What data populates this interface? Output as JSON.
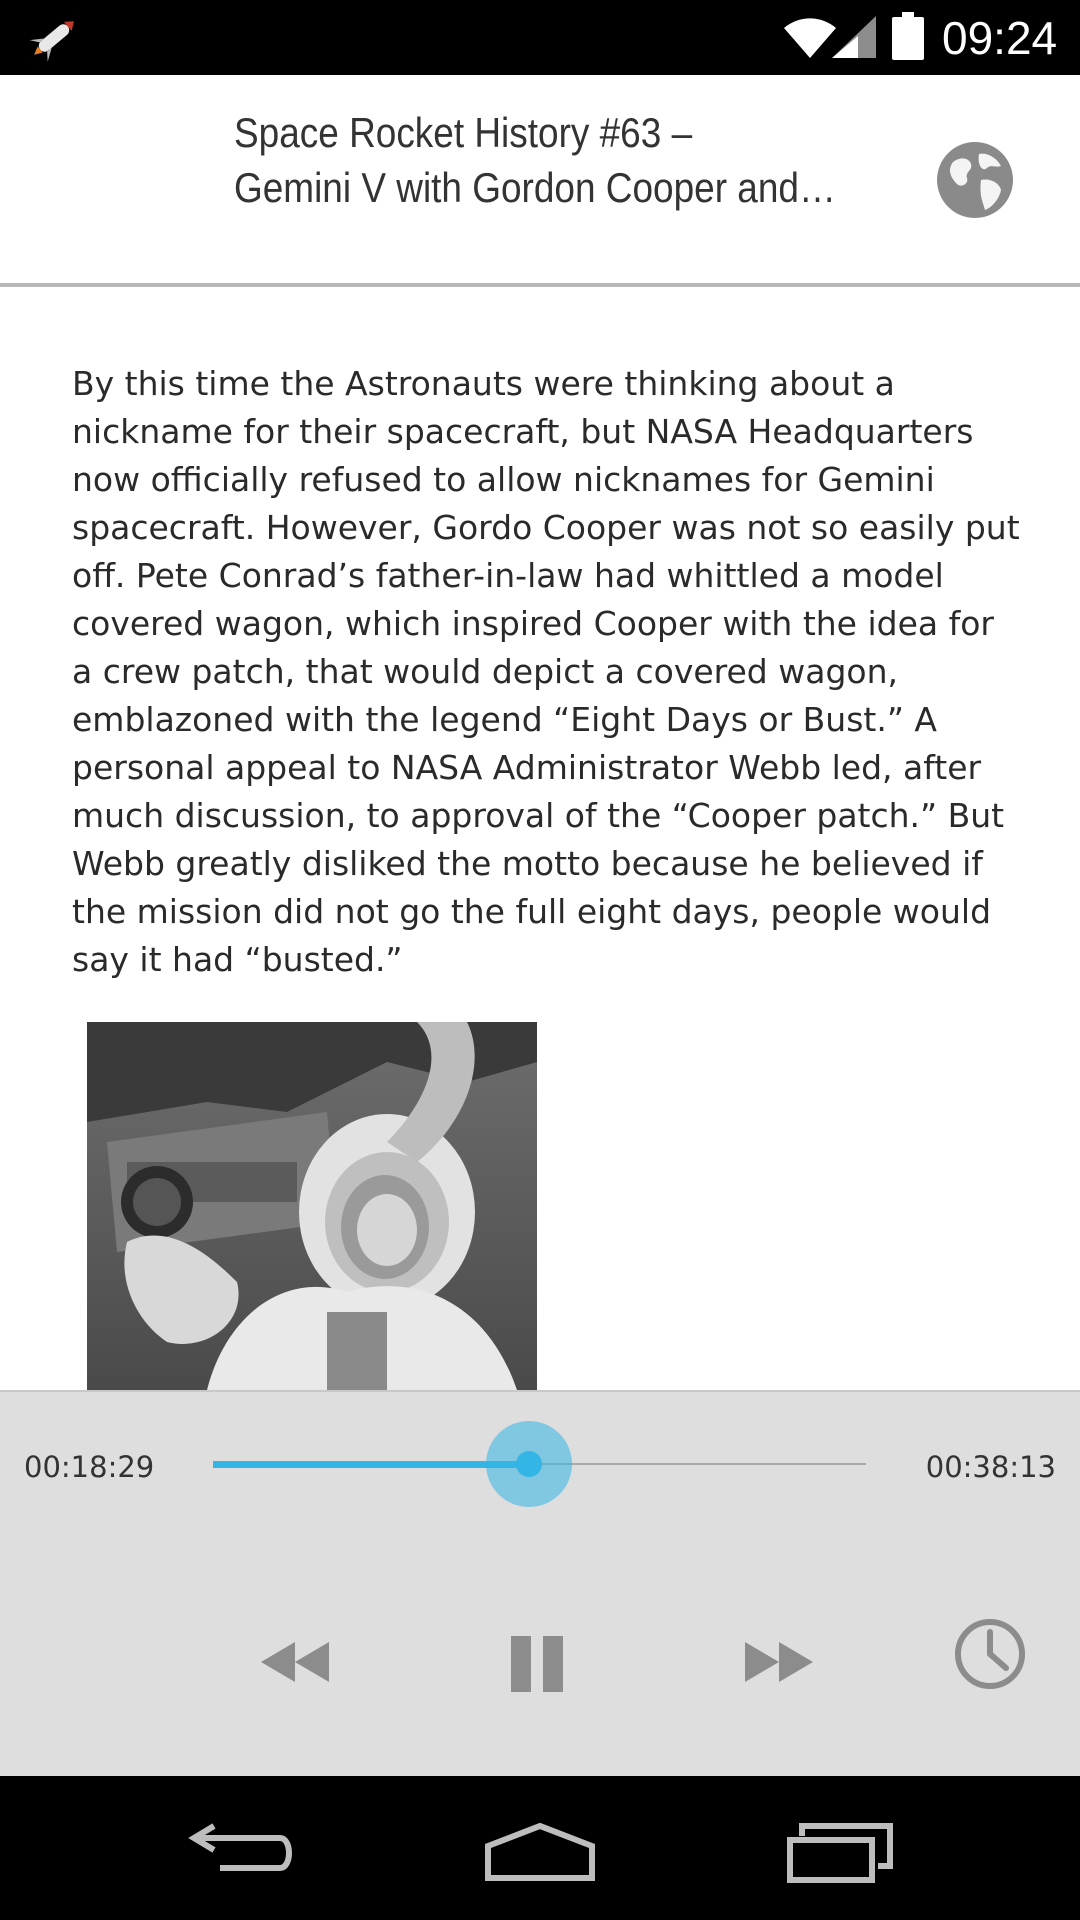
{
  "status_bar": {
    "time": "09:24",
    "icons": [
      "rocket-app-icon",
      "wifi-icon",
      "signal-icon",
      "battery-icon"
    ]
  },
  "header": {
    "title_line1": "Space Rocket History #63 –",
    "title_line2": "Gemini V with Gordon Cooper and…",
    "action_icon": "globe-icon"
  },
  "article": {
    "body": "By this time the Astronauts were thinking about a nickname for their spacecraft, but NASA Headquarters now officially refused to allow nicknames for Gemini spacecraft. However, Gordo Cooper was not so easily put off. Pete Conrad’s father-in-law had whittled a model covered wagon, which inspired Cooper with the idea for a crew patch, that would depict a covered wagon, emblazoned with the legend “Eight Days or Bust.” A personal appeal to NASA Administrator Webb led, after much discussion, to approval of the “Cooper patch.” But Webb greatly disliked the motto because he believed if the mission did not go the full eight days, people would say it had “busted.”",
    "image_icon": "astronaut-photo"
  },
  "player": {
    "elapsed": "00:18:29",
    "total": "00:38:13",
    "progress": 0.4837,
    "controls": [
      "rewind-icon",
      "pause-icon",
      "fast-forward-icon",
      "sleep-timer-icon"
    ],
    "accent_color": "#33b5e5"
  },
  "nav_bar": {
    "buttons": [
      "back-icon",
      "home-icon",
      "recents-icon"
    ]
  }
}
